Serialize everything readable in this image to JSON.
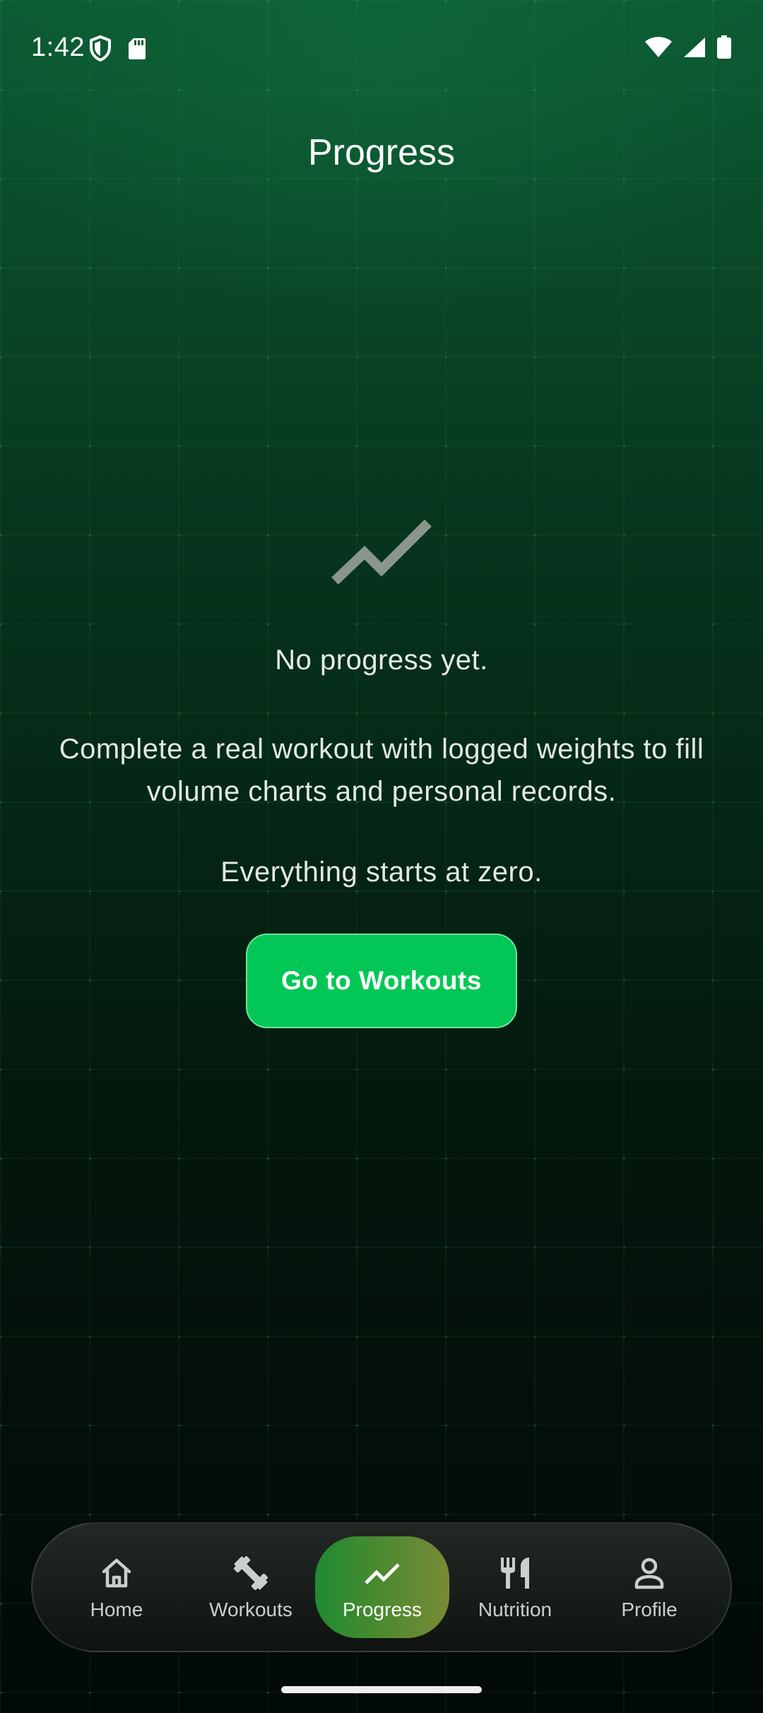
{
  "status_bar": {
    "time": "1:42",
    "icons": [
      "shield-icon",
      "sd-card-icon",
      "wifi-icon",
      "signal-icon",
      "battery-icon"
    ]
  },
  "header": {
    "title": "Progress"
  },
  "empty_state": {
    "icon": "trend-line-icon",
    "heading": "No progress yet.",
    "body": "Complete a real workout with logged weights to fill volume charts and personal records.",
    "subtext": "Everything starts at zero.",
    "button_label": "Go to Workouts"
  },
  "bottom_nav": {
    "items": [
      {
        "label": "Home",
        "icon": "home-icon",
        "active": false
      },
      {
        "label": "Workouts",
        "icon": "dumbbell-icon",
        "active": false
      },
      {
        "label": "Progress",
        "icon": "trend-icon",
        "active": true
      },
      {
        "label": "Nutrition",
        "icon": "utensils-icon",
        "active": false
      },
      {
        "label": "Profile",
        "icon": "person-icon",
        "active": false
      }
    ]
  },
  "colors": {
    "accent": "#02c756",
    "active_tab_start": "#1f8a32",
    "active_tab_end": "#7a8a36",
    "background_top": "#0b5a33",
    "background_bottom": "#020a06"
  }
}
